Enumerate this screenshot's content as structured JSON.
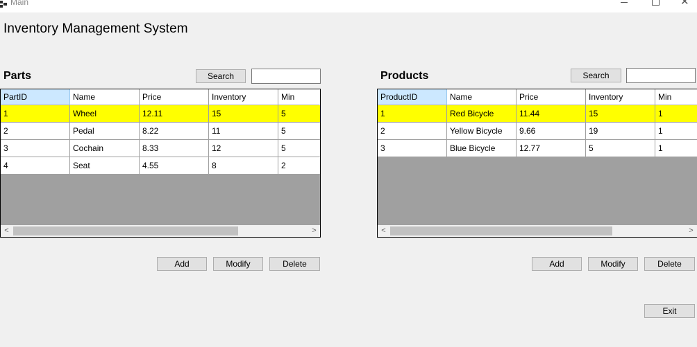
{
  "window": {
    "title": "Main",
    "min_symbol": "",
    "max_symbol": "",
    "close_symbol": "✕"
  },
  "app_title": "Inventory Management System",
  "parts": {
    "title": "Parts",
    "search_label": "Search",
    "search_value": "",
    "columns": [
      "PartID",
      "Name",
      "Price",
      "Inventory",
      "Min"
    ],
    "rows": [
      [
        "1",
        "Wheel",
        "12.11",
        "15",
        "5"
      ],
      [
        "2",
        "Pedal",
        "8.22",
        "11",
        "5"
      ],
      [
        "3",
        "Cochain",
        "8.33",
        "12",
        "5"
      ],
      [
        "4",
        "Seat",
        "4.55",
        "8",
        "2"
      ]
    ],
    "selected_row": 0,
    "add_label": "Add",
    "modify_label": "Modify",
    "delete_label": "Delete"
  },
  "products": {
    "title": "Products",
    "search_label": "Search",
    "search_value": "",
    "columns": [
      "ProductID",
      "Name",
      "Price",
      "Inventory",
      "Min"
    ],
    "rows": [
      [
        "1",
        "Red Bicycle",
        "11.44",
        "15",
        "1"
      ],
      [
        "2",
        "Yellow Bicycle",
        "9.66",
        "19",
        "1"
      ],
      [
        "3",
        "Blue Bicycle",
        "12.77",
        "5",
        "1"
      ]
    ],
    "selected_row": 0,
    "add_label": "Add",
    "modify_label": "Modify",
    "delete_label": "Delete"
  },
  "exit_label": "Exit",
  "scroll": {
    "left_arrow": "<",
    "right_arrow": ">"
  },
  "colors": {
    "selected_row": "#ffff00",
    "selected_header": "#cce8ff",
    "grid_background": "#a0a0a0"
  }
}
